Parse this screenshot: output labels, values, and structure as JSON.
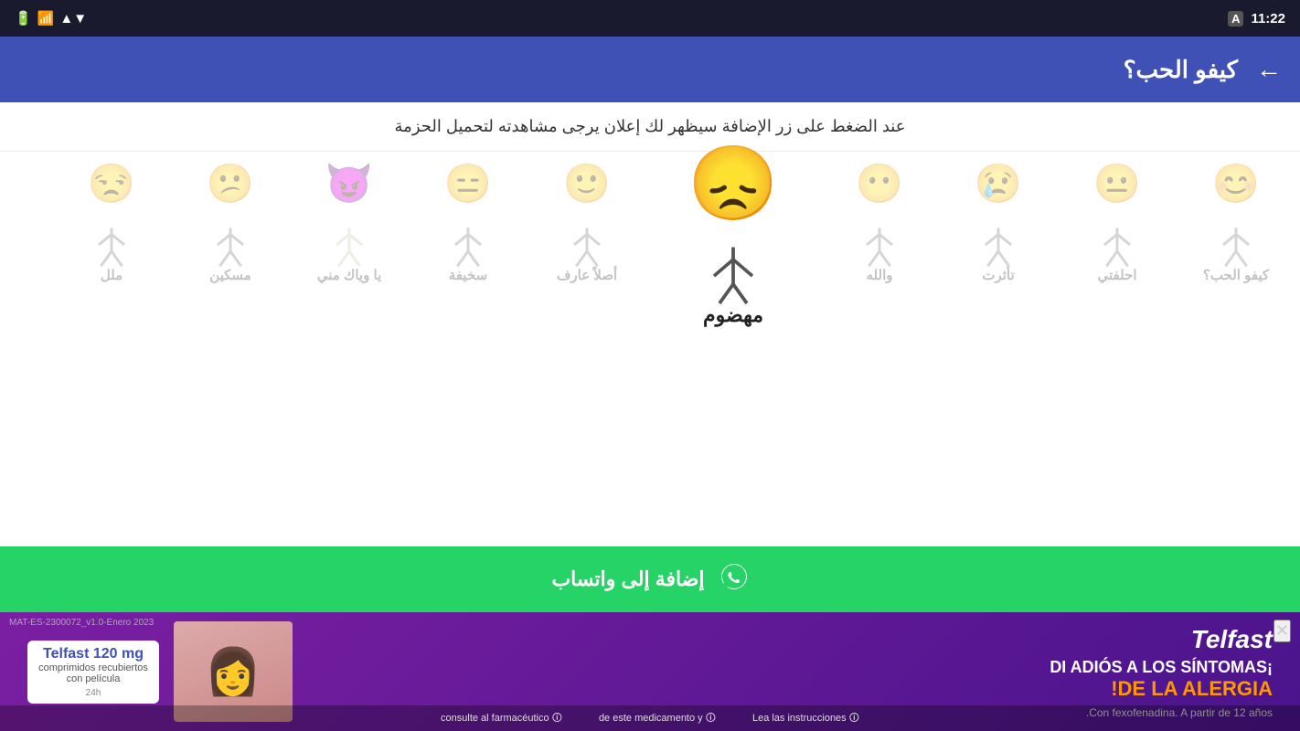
{
  "statusBar": {
    "time": "11:22",
    "batteryIcon": "🔋",
    "wifiIcon": "▼",
    "signalIcon": "▲"
  },
  "appBar": {
    "title": "كيفو الحب؟",
    "backLabel": "←"
  },
  "infoBanner": {
    "text": "عند الضغط على زر الإضافة سيظهر لك إعلان يرجى مشاهدته لتحميل الحزمة"
  },
  "stickers": [
    {
      "emoji": "😊",
      "label": "كيفو الحب",
      "featured": false
    },
    {
      "emoji": "😐",
      "label": "احلفتي",
      "featured": false
    },
    {
      "emoji": "😢",
      "label": "تأثرت",
      "featured": false
    },
    {
      "emoji": "😶",
      "label": "والله",
      "featured": false
    },
    {
      "emoji": "😞",
      "label": "مهضوم",
      "featured": true
    },
    {
      "emoji": "🙂",
      "label": "أصلاً عارف",
      "featured": false
    },
    {
      "emoji": "😐",
      "label": "سخيفة",
      "featured": false
    },
    {
      "emoji": "😈",
      "label": "يا وياك مني",
      "featured": false
    },
    {
      "emoji": "😕",
      "label": "مسكين",
      "featured": false
    },
    {
      "emoji": "😑",
      "label": "ملل",
      "featured": false
    }
  ],
  "featuredSticker": {
    "emoji": "😞",
    "label": "مهضوم"
  },
  "whatsappButton": {
    "label": "إضافة إلى واتساب",
    "icon": "💬"
  },
  "ad": {
    "mat": "MAT-ES-2300072_v1.0-Enero 2023",
    "brand": "Telfast",
    "headline": "¡DI ADIÓS A LOS SÍNTOMAS",
    "headline2": "DE LA ALERGIA!",
    "productName": "Telfast 120 mg",
    "productDesc": "comprimidos recubiertos con película",
    "subtext": "Con fexofenadina. A partir de 12 años.",
    "footnote1": "🛈 Lea las instrucciones",
    "footnote2": "🛈 de este medicamento y",
    "footnote3": "🛈 consulte al farmacéutico",
    "closeIcon": "✕"
  }
}
